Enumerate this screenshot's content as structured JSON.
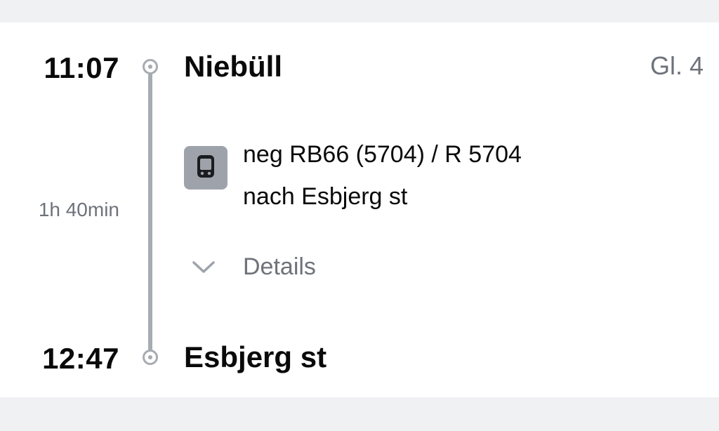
{
  "journey": {
    "departure": {
      "time": "11:07",
      "station": "Niebüll",
      "platform": "Gl. 4"
    },
    "arrival": {
      "time": "12:47",
      "station": "Esbjerg st"
    },
    "duration": "1h 40min",
    "train": {
      "icon": "train-icon",
      "line": "neg RB66 (5704) / R 5704",
      "destination": "nach Esbjerg st"
    },
    "details_label": "Details"
  },
  "colors": {
    "page_background": "#f0f1f3",
    "card_background": "#ffffff",
    "route_line": "#a7abb2",
    "secondary_text": "#6e727a",
    "icon_background": "#9ea3ab"
  }
}
